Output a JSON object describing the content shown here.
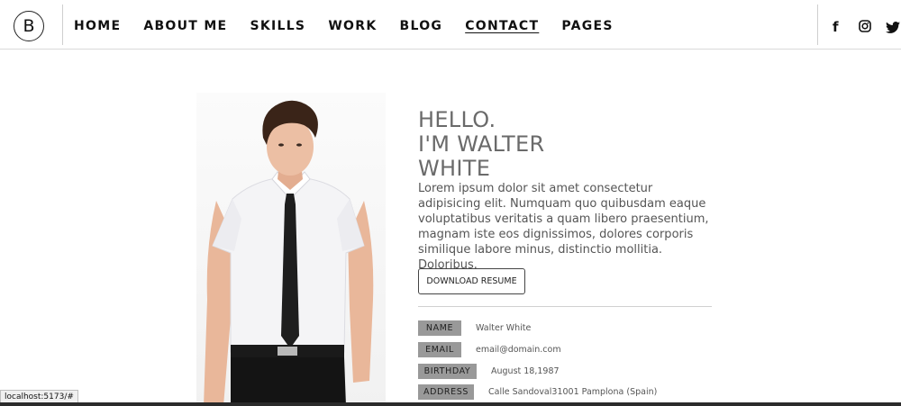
{
  "header": {
    "logo_letter": "B",
    "nav": [
      "HOME",
      "ABOUT ME",
      "SKILLS",
      "WORK",
      "BLOG",
      "CONTACT",
      "PAGES"
    ],
    "active": "CONTACT",
    "social": [
      "f",
      "instagram-icon",
      "twitter-icon"
    ]
  },
  "hero": {
    "line1": "HELLO.",
    "line2": "I'M WALTER",
    "line3": "WHITE",
    "bio": "Lorem ipsum dolor sit amet consectetur adipisicing elit. Numquam quo quibusdam eaque voluptatibus veritatis a quam libero praesentium, magnam iste eos dignissimos, dolores corporis similique labore minus, distinctio mollitia. Doloribus.",
    "button": "DOWNLOAD RESUME"
  },
  "info": [
    {
      "label": "NAME",
      "value": "Walter White"
    },
    {
      "label": "EMAIL",
      "value": "email@domain.com"
    },
    {
      "label": "BIRTHDAY",
      "value": "August 18,1987"
    },
    {
      "label": "ADDRESS",
      "value": "Calle Sandoval31001 Pamplona (Spain)"
    }
  ],
  "status_url": "localhost:5173/#"
}
